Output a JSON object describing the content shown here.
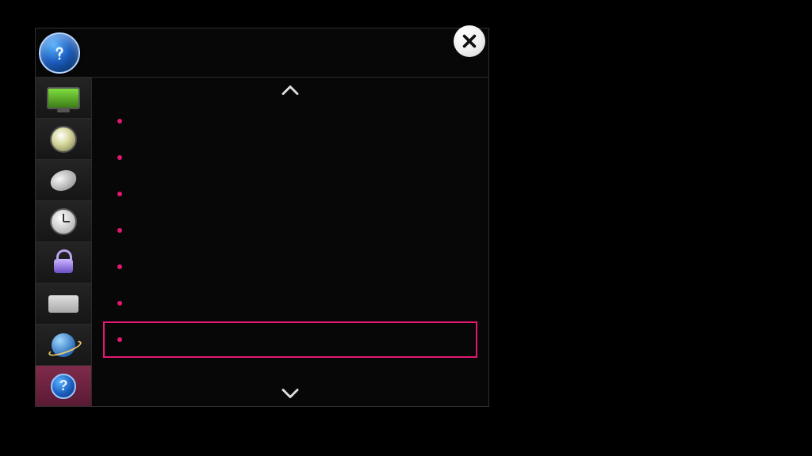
{
  "accent": "#e2186f",
  "title": "",
  "sidebar": {
    "items": [
      {
        "id": "picture",
        "icon": "tv-icon",
        "active": false
      },
      {
        "id": "sound",
        "icon": "speaker-icon",
        "active": false
      },
      {
        "id": "channel",
        "icon": "satellite-icon",
        "active": false
      },
      {
        "id": "time",
        "icon": "clock-icon",
        "active": false
      },
      {
        "id": "lock",
        "icon": "lock-icon",
        "active": false
      },
      {
        "id": "option",
        "icon": "toolbox-icon",
        "active": false
      },
      {
        "id": "network",
        "icon": "globe-icon",
        "active": false
      },
      {
        "id": "support",
        "icon": "help-icon",
        "active": true
      }
    ]
  },
  "list": {
    "selected_index": 6,
    "items": [
      {
        "label": ""
      },
      {
        "label": ""
      },
      {
        "label": ""
      },
      {
        "label": ""
      },
      {
        "label": ""
      },
      {
        "label": ""
      },
      {
        "label": ""
      }
    ]
  }
}
